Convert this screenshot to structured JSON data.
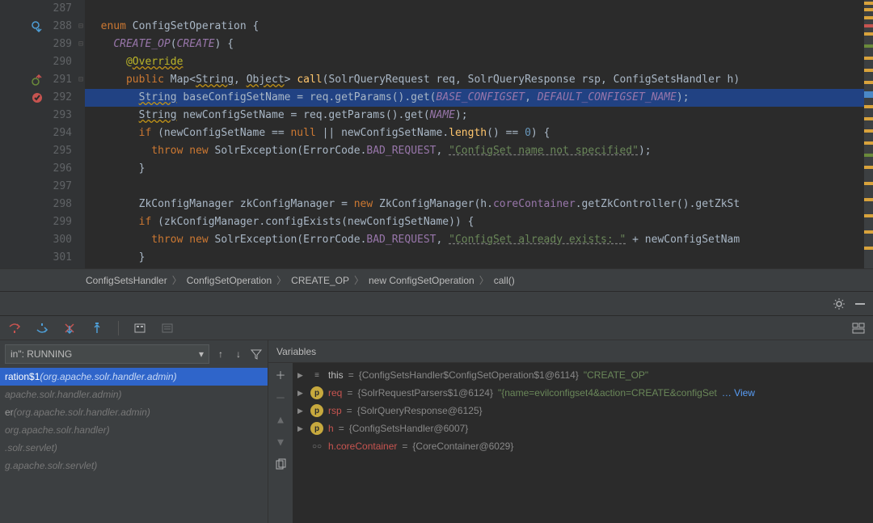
{
  "gutter": {
    "lines": [
      287,
      288,
      289,
      290,
      291,
      292,
      293,
      294,
      295,
      296,
      297,
      298,
      299,
      300,
      301
    ]
  },
  "code": {
    "l287": "",
    "l288_kw": "enum",
    "l288_name": " ConfigSetOperation {",
    "l289_const": "CREATE_OP",
    "l289_rest": "(",
    "l289_arg": "CREATE",
    "l289_rest2": ") {",
    "l290_at": "@",
    "l290_ann": "Override",
    "l291_kw1": "public",
    "l291_type": " Map<",
    "l291_gen1": "String",
    "l291_c1": ", ",
    "l291_gen2": "Object",
    "l291_c2": "> ",
    "l291_fn": "call",
    "l291_sig": "(SolrQueryRequest req, SolrQueryResponse rsp, ConfigSetsHandler h)",
    "l292_type": "String",
    "l292_a": " baseConfigSetName = req.getParams().get(",
    "l292_c1": "BASE_CONFIGSET",
    "l292_c2": ", ",
    "l292_c3": "DEFAULT_CONFIGSET_NAME",
    "l292_c4": ");",
    "l293_type": "String",
    "l293_a": " newConfigSetName = req.getParams().get(",
    "l293_c1": "NAME",
    "l293_c2": ");",
    "l294_kw": "if",
    "l294_a": " (newConfigSetName == ",
    "l294_null": "null",
    "l294_b": " || newConfigSetName.",
    "l294_fn": "length",
    "l294_c": "() == ",
    "l294_num": "0",
    "l294_d": ") {",
    "l295_kw": "throw new",
    "l295_a": " SolrException(ErrorCode.",
    "l295_f": "BAD_REQUEST",
    "l295_b": ", ",
    "l295_s": "\"ConfigSet name not specified\"",
    "l295_c": ");",
    "l296": "}",
    "l298_a": "ZkConfigManager zkConfigManager = ",
    "l298_kw": "new",
    "l298_b": " ZkConfigManager(h.",
    "l298_f": "coreContainer",
    "l298_c": ".getZkController().getZkSt",
    "l299_kw": "if",
    "l299_a": " (zkConfigManager.configExists(newConfigSetName)) {",
    "l300_kw": "throw new",
    "l300_a": " SolrException(ErrorCode.",
    "l300_f": "BAD_REQUEST",
    "l300_b": ", ",
    "l300_s": "\"ConfigSet already exists: \"",
    "l300_c": " + newConfigSetNam",
    "l301": "}"
  },
  "breadcrumbs": [
    "ConfigSetsHandler",
    "ConfigSetOperation",
    "CREATE_OP",
    "new ConfigSetOperation",
    "call()"
  ],
  "thread": "in\": RUNNING",
  "frames": [
    {
      "name": "ration$1",
      "pkg": "(org.apache.solr.handler.admin)",
      "sel": true
    },
    {
      "name": "",
      "pkg": "apache.solr.handler.admin)",
      "sel": false
    },
    {
      "name": "er ",
      "pkg": "(org.apache.solr.handler.admin)",
      "sel": false
    },
    {
      "name": "",
      "pkg": "org.apache.solr.handler)",
      "sel": false
    },
    {
      "name": "",
      "pkg": ".solr.servlet)",
      "sel": false
    },
    {
      "name": "",
      "pkg": "g.apache.solr.servlet)",
      "sel": false
    }
  ],
  "varsTitle": "Variables",
  "vars": [
    {
      "ico": "obj",
      "name": "this",
      "val": "{ConfigSetsHandler$ConfigSetOperation$1@6114}",
      "str": "\"CREATE_OP\"",
      "link": ""
    },
    {
      "ico": "p",
      "name": "req",
      "val": "{SolrRequestParsers$1@6124}",
      "str": "\"{name=evilconfigset4&action=CREATE&configSet",
      "link": "… View"
    },
    {
      "ico": "p",
      "name": "rsp",
      "val": "{SolrQueryResponse@6125}",
      "str": "",
      "link": ""
    },
    {
      "ico": "p",
      "name": "h",
      "val": "{ConfigSetsHandler@6007}",
      "str": "",
      "link": ""
    },
    {
      "ico": "oo",
      "name": "h.coreContainer",
      "val": "{CoreContainer@6029}",
      "str": "",
      "link": ""
    }
  ]
}
